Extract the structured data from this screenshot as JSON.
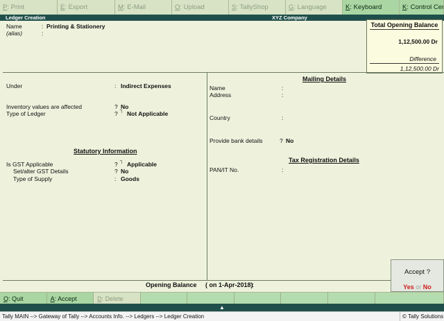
{
  "top_bar": [
    {
      "key": "P",
      "label": ": Print",
      "active": false
    },
    {
      "key": "E",
      "label": ": Export",
      "active": false
    },
    {
      "key": "M",
      "label": ": E-Mail",
      "active": false
    },
    {
      "key": "O",
      "label": ": Upload",
      "active": false
    },
    {
      "key": "S",
      "label": ": TallyShop",
      "active": false
    },
    {
      "key": "G",
      "label": ": Language",
      "active": false
    },
    {
      "key": "K",
      "label": ": Keyboard",
      "active": true
    },
    {
      "key": "K",
      "label": ": Control Centre",
      "active": true
    }
  ],
  "title": {
    "screen": "Ledger Creation",
    "company": "XYZ Company"
  },
  "ledger": {
    "name_label": "Name",
    "name_colon": ":",
    "name_value": "Printing & Stationery",
    "alias_label": "(alias)",
    "alias_colon": ":"
  },
  "opening_box": {
    "title": "Total Opening Balance",
    "amount": "1,12,500.00 Dr",
    "difference_label": "Difference",
    "difference_amount": "1,12,500.00 Dr"
  },
  "left_fields": {
    "under_label": "Under",
    "under_sep": ":",
    "under_value": "Indirect Expenses",
    "inventory_label": "Inventory values are affected",
    "inventory_sep": "?",
    "inventory_value": "No",
    "type_label": "Type of Ledger",
    "type_sep": "?",
    "type_value": "Not Applicable",
    "statutory_title": "Statutory Information",
    "gst_label": "Is GST Applicable",
    "gst_sep": "?",
    "gst_value": "Applicable",
    "setalter_label": "Set/alter GST Details",
    "setalter_sep": "?",
    "setalter_value": "No",
    "supply_label": "Type of Supply",
    "supply_sep": ":",
    "supply_value": "Goods",
    "enum_glyph": "┐"
  },
  "mailing": {
    "title": "Mailing Details",
    "name_label": "Name",
    "address_label": "Address",
    "country_label": "Country",
    "colon": ":",
    "bank_label": "Provide bank details",
    "bank_sep": "?",
    "bank_value": "No"
  },
  "tax": {
    "title": "Tax Registration Details",
    "pan_label": "PAN/IT No.",
    "colon": ":"
  },
  "footer": {
    "opening_label": "Opening Balance",
    "opening_date": "( on 1-Apr-2018)",
    "opening_colon": ":"
  },
  "accept_dialog": {
    "question": "Accept ?",
    "yes": "Yes",
    "or": "or",
    "no": "No"
  },
  "bottom_bar": [
    {
      "key": "Q",
      "label": ": Quit",
      "active": true
    },
    {
      "key": "A",
      "label": ": Accept",
      "active": true
    },
    {
      "key": "D",
      "label": ": Delete",
      "active": false
    },
    {
      "key": "",
      "label": "",
      "active": false
    },
    {
      "key": "",
      "label": "",
      "active": false
    },
    {
      "key": "",
      "label": "",
      "active": false
    },
    {
      "key": "",
      "label": "",
      "active": false
    },
    {
      "key": "",
      "label": "",
      "active": false
    },
    {
      "key": "",
      "label": "",
      "active": false
    },
    {
      "key": "",
      "label": "",
      "active": false
    }
  ],
  "collapse_icon": "chevron-up-icon",
  "collapse_glyph": "▲",
  "status_bar": {
    "breadcrumb": "Tally MAIN --> Gateway of Tally --> Accounts Info. --> Ledgers --> Ledger Creation",
    "copyright": "© Tally Solutions"
  },
  "colors": {
    "title_bar": "#1f4f4b",
    "active_key": "#a9d6a2",
    "inactive_key": "#d7e3c4",
    "accept_yes_no": "#d21a1a"
  }
}
